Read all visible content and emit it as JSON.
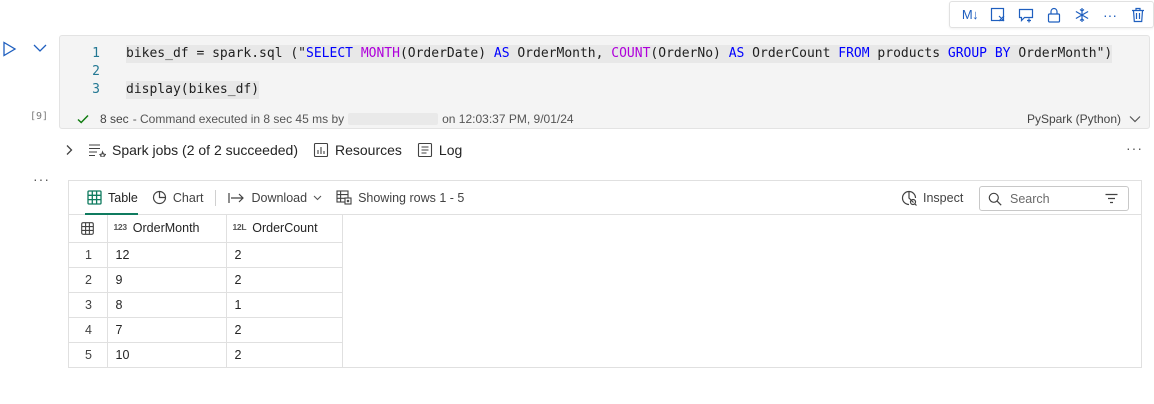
{
  "cell_toolbar": {
    "markdown_label": "M↓",
    "more_label": "···"
  },
  "cell": {
    "execution_count": "[9]",
    "code_lines": [
      {
        "num": "1"
      },
      {
        "num": "2"
      },
      {
        "num": "3"
      }
    ],
    "code": {
      "l1_a": "bikes_df = spark.sql (\"",
      "l1_kw1": "SELECT",
      "l1_fn1": "MONTH",
      "l1_b": "(OrderDate) ",
      "l1_kw2": "AS",
      "l1_c": " OrderMonth, ",
      "l1_fn2": "COUNT",
      "l1_d": "(OrderNo) ",
      "l1_kw3": "AS",
      "l1_e": " OrderCount ",
      "l1_kw4": "FROM",
      "l1_f": " products ",
      "l1_kw5": "GROUP",
      "l1_g": " ",
      "l1_kw6": "BY",
      "l1_h": " OrderMonth\")",
      "l3": "display(bikes_df)"
    },
    "status": {
      "duration": "8 sec",
      "message": "- Command executed in 8 sec 45 ms by",
      "timestamp": "on 12:03:37 PM, 9/01/24",
      "language": "PySpark (Python)"
    }
  },
  "jobs_row": {
    "spark_jobs": "Spark jobs (2 of 2 succeeded)",
    "resources": "Resources",
    "log": "Log",
    "more": "···"
  },
  "output": {
    "more": "···",
    "tabs": {
      "table": "Table",
      "chart": "Chart"
    },
    "download": "Download",
    "rows_info": "Showing rows 1 - 5",
    "inspect": "Inspect",
    "search_placeholder": "Search",
    "columns": [
      {
        "type": "123",
        "name": "OrderMonth"
      },
      {
        "type": "12L",
        "name": "OrderCount"
      }
    ],
    "rows": [
      {
        "idx": "1",
        "month": "12",
        "count": "2"
      },
      {
        "idx": "2",
        "month": "9",
        "count": "2"
      },
      {
        "idx": "3",
        "month": "8",
        "count": "1"
      },
      {
        "idx": "4",
        "month": "7",
        "count": "2"
      },
      {
        "idx": "5",
        "month": "10",
        "count": "2"
      }
    ]
  },
  "colors": {
    "accent_blue": "#1f5fbf",
    "success_green": "#107c10",
    "table_tab_underline": "#0f7b5f",
    "keyword_blue": "#0000ff",
    "function_purple": "#af00db"
  }
}
